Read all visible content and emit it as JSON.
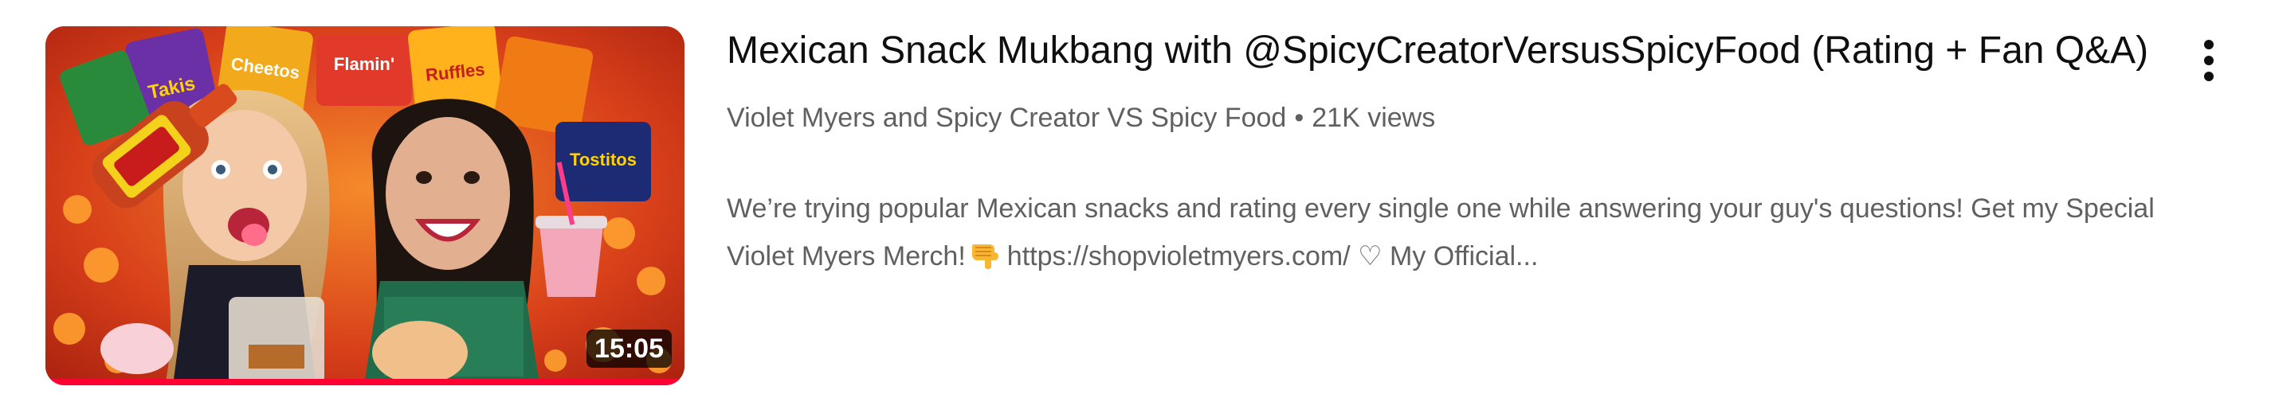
{
  "video": {
    "title": "Mexican Snack Mukbang with @SpicyCreatorVersusSpicyFood  (Rating + Fan Q&A)",
    "channels": "Violet Myers and Spicy Creator VS Spicy Food",
    "separator": "•",
    "views": "21K views",
    "duration": "15:05",
    "watch_progress": 1.0,
    "snippet_part1": "We’re trying popular Mexican snacks and rating every single one while answering your guy's questions! Get my Special Violet Myers Merch!",
    "snippet_emoji": "point-down-hand-icon",
    "snippet_part2": "https://shopvioletmyers.com/ ♡ My Official..."
  },
  "thumbnail": {
    "brand_labels": [
      "Takis",
      "Cheetos",
      "Flamin'",
      "Ruffles",
      "Tostitos"
    ],
    "colors": {
      "background": "#d9491e",
      "progress": "#ff0033"
    }
  },
  "menu": {
    "icon": "more-vert-icon"
  }
}
